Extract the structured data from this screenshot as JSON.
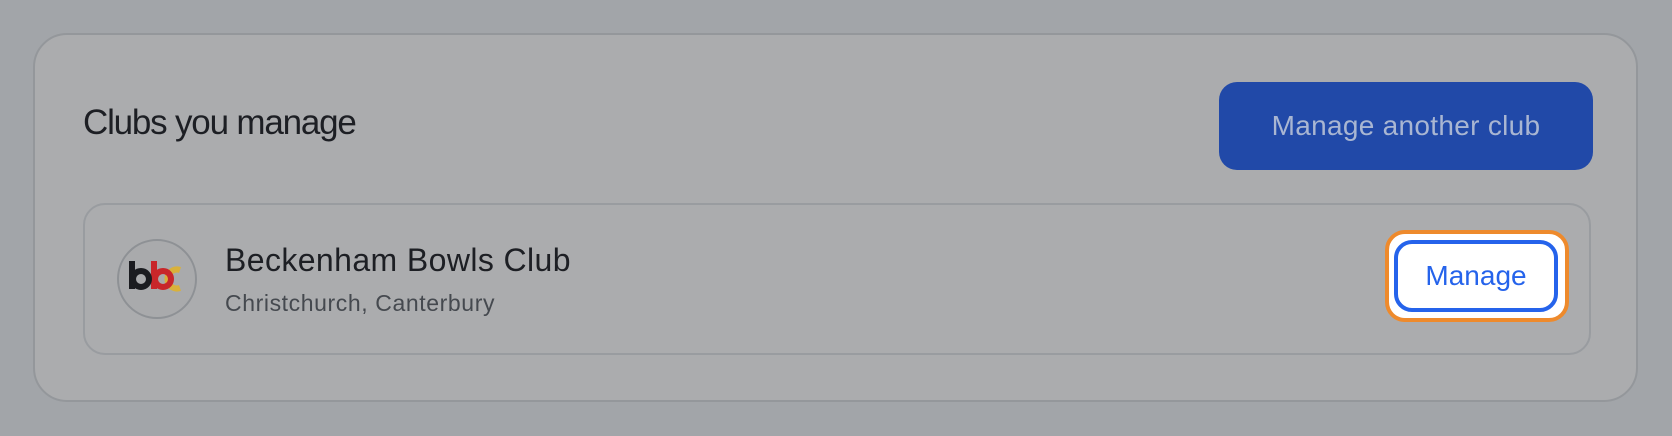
{
  "section": {
    "title": "Clubs you manage",
    "primary_action_label": "Manage another club"
  },
  "clubs": [
    {
      "name": "Beckenham Bowls Club",
      "location": "Christchurch, Canterbury",
      "logo_letters": "bbc",
      "logo_colors": [
        "#1b1c20",
        "#c8262a",
        "#d9b13a"
      ],
      "action_label": "Manage"
    }
  ],
  "colors": {
    "accent": "#2563eb",
    "primary_button_bg": "#2149a8",
    "focus_ring": "#ee8a2c"
  }
}
